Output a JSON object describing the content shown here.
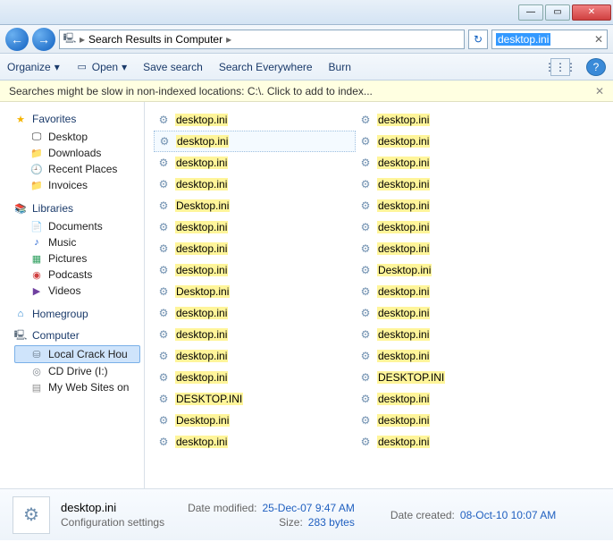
{
  "titlebar": {
    "min": "—",
    "max": "▭",
    "close": "✕"
  },
  "addr": {
    "back": "←",
    "fwd": "→",
    "crumb1": "Search Results in Computer",
    "sep": "▸",
    "refresh": "↻",
    "search_value": "desktop.ini",
    "clear": "✕"
  },
  "cmd": {
    "organize": "Organize",
    "open": "Open",
    "save": "Save search",
    "everywhere": "Search Everywhere",
    "burn": "Burn",
    "view": "⋮⋮⋮",
    "help": "?"
  },
  "info": {
    "msg": "Searches might be slow in non-indexed locations: C:\\. Click to add to index...",
    "close": "✕"
  },
  "nav": {
    "fav": "Favorites",
    "fav_items": {
      "desktop": "Desktop",
      "downloads": "Downloads",
      "recent": "Recent Places",
      "invoices": "Invoices"
    },
    "lib": "Libraries",
    "lib_items": {
      "documents": "Documents",
      "music": "Music",
      "pictures": "Pictures",
      "podcasts": "Podcasts",
      "videos": "Videos"
    },
    "home": "Homegroup",
    "comp": "Computer",
    "comp_items": {
      "local": "Local Crack Hou",
      "cd": "CD Drive (I:)",
      "web": "My Web Sites on"
    }
  },
  "results": {
    "col1": [
      "desktop.ini",
      "desktop.ini",
      "desktop.ini",
      "desktop.ini",
      "Desktop.ini",
      "desktop.ini",
      "desktop.ini",
      "desktop.ini",
      "Desktop.ini",
      "desktop.ini",
      "desktop.ini",
      "desktop.ini",
      "desktop.ini",
      "DESKTOP.INI",
      "Desktop.ini",
      "desktop.ini"
    ],
    "col2": [
      "desktop.ini",
      "desktop.ini",
      "desktop.ini",
      "desktop.ini",
      "desktop.ini",
      "desktop.ini",
      "desktop.ini",
      "Desktop.ini",
      "desktop.ini",
      "desktop.ini",
      "desktop.ini",
      "desktop.ini",
      "DESKTOP.INI",
      "desktop.ini",
      "desktop.ini",
      "desktop.ini"
    ],
    "selected_index": 1
  },
  "details": {
    "filename": "desktop.ini",
    "filetype": "Configuration settings",
    "modified_k": "Date modified:",
    "modified_v": "25-Dec-07 9:47 AM",
    "size_k": "Size:",
    "size_v": "283 bytes",
    "created_k": "Date created:",
    "created_v": "08-Oct-10 10:07 AM"
  }
}
